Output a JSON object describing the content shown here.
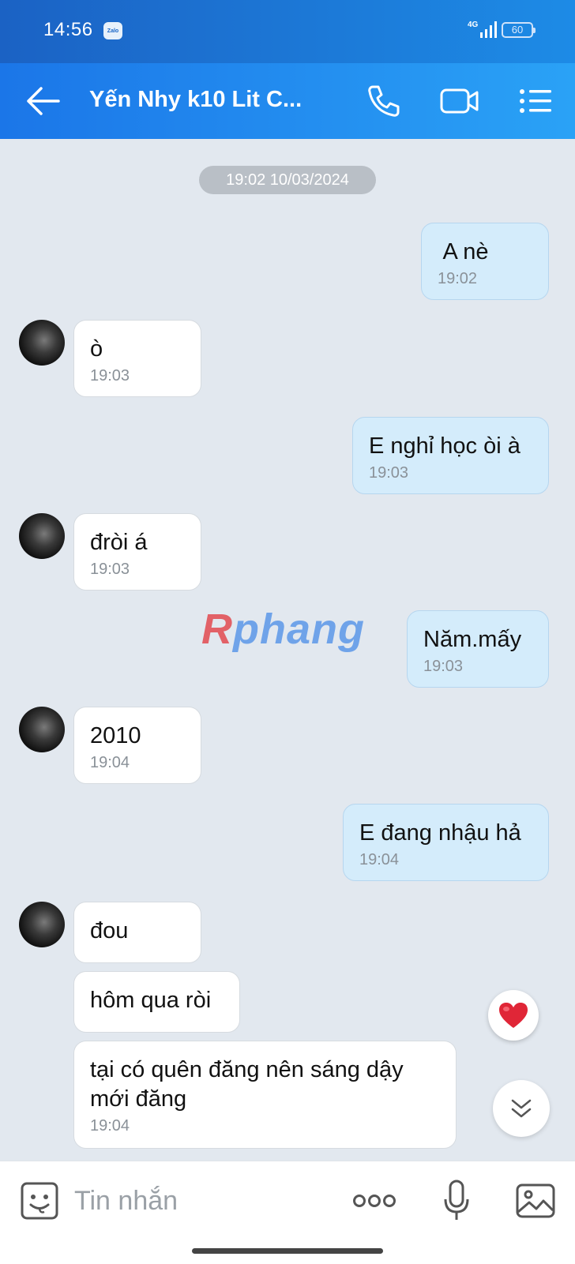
{
  "status_bar": {
    "time": "14:56",
    "app_badge": "Zalo",
    "network": "4G",
    "battery": "60"
  },
  "header": {
    "title": "Yến Nhy k10 Lit C..."
  },
  "date_separator": "19:02 10/03/2024",
  "messages": [
    {
      "dir": "out",
      "text": " A nè",
      "time": "19:02"
    },
    {
      "dir": "in",
      "text": "ò",
      "time": "19:03"
    },
    {
      "dir": "out",
      "text": "E nghỉ học òi à",
      "time": "19:03"
    },
    {
      "dir": "in",
      "text": "đròi á",
      "time": "19:03"
    },
    {
      "dir": "out",
      "text": "Năm.mấy",
      "time": "19:03"
    },
    {
      "dir": "in",
      "text": "2010",
      "time": "19:04"
    },
    {
      "dir": "out",
      "text": "E đang nhậu hả",
      "time": "19:04"
    },
    {
      "dir": "in",
      "text": "đou",
      "time": ""
    },
    {
      "dir": "in",
      "text": "hôm qua ròi",
      "time": ""
    },
    {
      "dir": "in",
      "text": "tại có quên đăng nên sáng dậy\nmới đăng",
      "time": "19:04"
    }
  ],
  "watermark": {
    "first": "R",
    "rest": "phang"
  },
  "input": {
    "placeholder": "Tin nhắn"
  },
  "colors": {
    "accent": "#1b76e8",
    "outgoing_bubble": "#d4ecfb",
    "incoming_bubble": "#ffffff",
    "heart": "#e02637"
  }
}
